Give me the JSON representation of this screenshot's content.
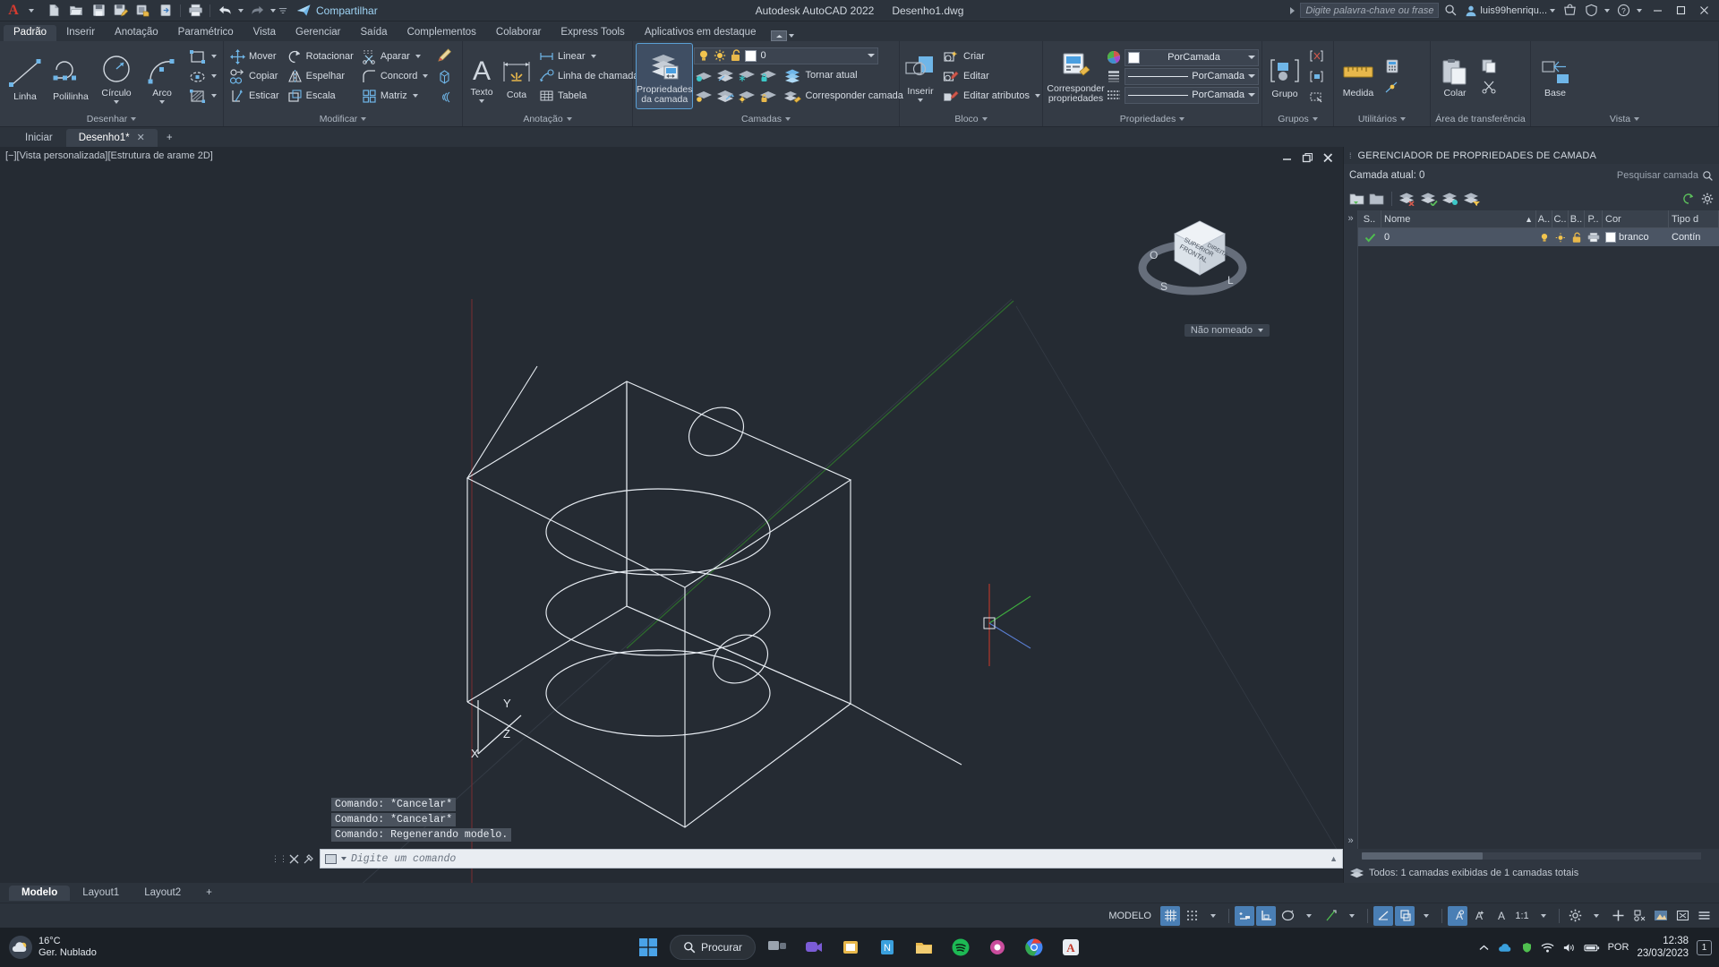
{
  "titlebar": {
    "app_title": "Autodesk AutoCAD 2022",
    "file_name": "Desenho1.dwg",
    "share_label": "Compartilhar",
    "search_placeholder": "Digite palavra-chave ou frase",
    "user_name": "luis99henriqu...",
    "qat_items": [
      "new-icon",
      "open-icon",
      "save-icon",
      "save-as-icon",
      "plot-preview-icon",
      "export-icon",
      "print-icon",
      "undo-icon",
      "redo-icon",
      "customize-icon"
    ],
    "window_controls": [
      "minimize",
      "maximize",
      "close"
    ]
  },
  "ribbon": {
    "tabs": [
      {
        "label": "Padrão",
        "active": true
      },
      {
        "label": "Inserir",
        "active": false
      },
      {
        "label": "Anotação",
        "active": false
      },
      {
        "label": "Paramétrico",
        "active": false
      },
      {
        "label": "Vista",
        "active": false
      },
      {
        "label": "Gerenciar",
        "active": false
      },
      {
        "label": "Saída",
        "active": false
      },
      {
        "label": "Complementos",
        "active": false
      },
      {
        "label": "Colaborar",
        "active": false
      },
      {
        "label": "Express Tools",
        "active": false
      },
      {
        "label": "Aplicativos em destaque",
        "active": false
      }
    ],
    "panels": {
      "desenhar": {
        "title": "Desenhar",
        "big": [
          {
            "label": "Linha",
            "icon": "line-icon"
          },
          {
            "label": "Polilinha",
            "icon": "polyline-icon"
          },
          {
            "label": "Círculo",
            "icon": "circle-icon",
            "dropdown": true
          },
          {
            "label": "Arco",
            "icon": "arc-icon",
            "dropdown": true
          }
        ],
        "small_icons": [
          "rectangle-icon",
          "ellipse-icon",
          "hatch-icon"
        ]
      },
      "modificar": {
        "title": "Modificar",
        "items": [
          {
            "label": "Mover",
            "icon": "move-icon"
          },
          {
            "label": "Rotacionar",
            "icon": "rotate-icon"
          },
          {
            "label": "Aparar",
            "icon": "trim-icon",
            "dropdown": true
          },
          {
            "label": "Copiar",
            "icon": "copy-icon"
          },
          {
            "label": "Espelhar",
            "icon": "mirror-icon"
          },
          {
            "label": "Concord",
            "icon": "fillet-icon",
            "dropdown": true
          },
          {
            "label": "Esticar",
            "icon": "stretch-icon"
          },
          {
            "label": "Escala",
            "icon": "scale-icon"
          },
          {
            "label": "Matriz",
            "icon": "array-icon",
            "dropdown": true
          }
        ],
        "extra_icons": [
          "erase-brush-icon",
          "solid-edit-icon",
          "offset-icon"
        ]
      },
      "anotacao": {
        "title": "Anotação",
        "big": [
          {
            "label": "Texto",
            "icon": "text-icon",
            "dropdown": true
          },
          {
            "label": "Cota",
            "icon": "dimension-icon"
          }
        ],
        "items": [
          {
            "label": "Linear",
            "icon": "linear-dim-icon",
            "dropdown": true
          },
          {
            "label": "Linha de chamada",
            "icon": "leader-icon",
            "dropdown": true
          },
          {
            "label": "Tabela",
            "icon": "table-icon"
          }
        ]
      },
      "camadas": {
        "title": "Camadas",
        "big": {
          "label": "Propriedades da camada",
          "icon": "layer-properties-icon",
          "selected": true
        },
        "layer_value": "0",
        "toggle_icons": [
          "lightbulb-on-icon",
          "sun-icon",
          "unlock-icon"
        ],
        "items": [
          {
            "label": "Tornar atual",
            "icon": "make-current-icon"
          },
          {
            "label": "Corresponder camada",
            "icon": "match-layer-icon"
          }
        ],
        "row1_icons": [
          "layer-isolate-icon",
          "layer-off-icon",
          "layer-freeze-icon",
          "layer-lock-icon"
        ],
        "row2_icons": [
          "layer-unisolate-icon",
          "layer-on-icon",
          "layer-thaw-icon",
          "layer-unlock-icon"
        ]
      },
      "bloco": {
        "title": "Bloco",
        "big": {
          "label": "Inserir",
          "icon": "insert-block-icon",
          "dropdown": true
        },
        "items": [
          {
            "label": "Criar",
            "icon": "create-block-icon"
          },
          {
            "label": "Editar",
            "icon": "edit-block-icon"
          },
          {
            "label": "Editar atributos",
            "icon": "edit-attributes-icon",
            "dropdown": true
          }
        ]
      },
      "propriedades": {
        "title": "Propriedades",
        "big": {
          "label": "Corresponder propriedades",
          "icon": "match-properties-icon"
        },
        "rows": [
          {
            "icon": "color-wheel-icon",
            "value": "PorCamada",
            "kind": "color"
          },
          {
            "icon": "lineweight-icon",
            "value": "PorCamada",
            "kind": "line"
          },
          {
            "icon": "linetype-icon",
            "value": "PorCamada",
            "kind": "line"
          }
        ]
      },
      "grupos": {
        "title": "Grupos",
        "big": {
          "label": "Grupo",
          "icon": "group-icon"
        },
        "side_icons": [
          "ungroup-icon",
          "group-edit-icon",
          "group-select-icon"
        ]
      },
      "utilitarios": {
        "title": "Utilitários",
        "big": {
          "label": "Medida",
          "icon": "measure-icon"
        },
        "side_icons": [
          "quick-calc-icon",
          "id-point-icon"
        ]
      },
      "area_transferencia": {
        "title": "Área de transferência",
        "big": {
          "label": "Colar",
          "icon": "paste-icon"
        },
        "side_icons": [
          "copy-clip-icon",
          "cut-clip-icon"
        ]
      },
      "vista": {
        "title": "Vista",
        "big": {
          "label": "Base",
          "icon": "base-view-icon"
        }
      }
    }
  },
  "document_tabs": [
    {
      "label": "Iniciar",
      "active": false,
      "closable": false
    },
    {
      "label": "Desenho1*",
      "active": true,
      "closable": true
    }
  ],
  "document_tab_add": "+",
  "canvas": {
    "viewport_label": "[−][Vista personalizada][Estrutura de arame 2D]",
    "viewcube_faces": {
      "front": "FRONTAL",
      "right": "DIREITA",
      "top": "SUPERIOR"
    },
    "compass": {
      "north": "O",
      "south": "S",
      "east": "L"
    },
    "viewcube_menu": "Não nomeado",
    "ucs_axes": [
      "X",
      "Y",
      "Z"
    ],
    "window_controls": [
      "minimize",
      "restore",
      "close"
    ]
  },
  "command": {
    "history": [
      "Comando: *Cancelar*",
      "Comando: *Cancelar*",
      "Comando:  Regenerando modelo."
    ],
    "placeholder": "Digite um comando"
  },
  "layer_palette": {
    "title": "GERENCIADOR DE PROPRIEDADES DE CAMADA",
    "current_layer_label": "Camada atual: 0",
    "search_placeholder": "Pesquisar camada",
    "columns": [
      "S..",
      "Nome",
      "A..",
      "C..",
      "B..",
      "P..",
      "Cor",
      "Tipo d"
    ],
    "rows": [
      {
        "status": "current",
        "nome": "0",
        "a": "on",
        "c": "on",
        "b": "unlock",
        "p": "plot",
        "cor": "branco",
        "tipo": "Contín"
      }
    ],
    "footer": "Todos: 1 camadas exibidas de 1 camadas totais",
    "toolbar_icons": [
      "new-layer-icon",
      "new-layer-vp-icon",
      "delete-layer-icon",
      "set-current-icon",
      "layer-states-icon",
      "layer-filter-icon"
    ],
    "toolbar_right_icons": [
      "refresh-icon",
      "settings-icon"
    ]
  },
  "layout_tabs": [
    {
      "label": "Modelo",
      "active": true
    },
    {
      "label": "Layout1",
      "active": false
    },
    {
      "label": "Layout2",
      "active": false
    }
  ],
  "layout_add": "+",
  "statusbar": {
    "space_label": "MODELO",
    "scale": "1:1",
    "toggles": [
      {
        "name": "grid-display-toggle",
        "on": true
      },
      {
        "name": "snap-mode-toggle",
        "on": false
      },
      {
        "name": "infer-constraints-toggle",
        "on": true
      },
      {
        "name": "ortho-mode-toggle",
        "on": true
      },
      {
        "name": "polar-tracking-toggle",
        "on": false
      },
      {
        "name": "object-snap-tracking-toggle",
        "on": false
      },
      {
        "name": "object-snap-toggle",
        "on": true
      },
      {
        "name": "lineweight-toggle",
        "on": true
      },
      {
        "name": "transparency-toggle",
        "on": false
      },
      {
        "name": "annotation-visibility-toggle",
        "on": true
      },
      {
        "name": "autoscale-toggle",
        "on": false
      },
      {
        "name": "annotation-scale-toggle",
        "on": false
      },
      {
        "name": "workspace-switching-icon",
        "on": false
      },
      {
        "name": "hardware-acceleration-icon",
        "on": false
      },
      {
        "name": "isolate-objects-icon",
        "on": false
      },
      {
        "name": "clean-screen-icon",
        "on": false
      },
      {
        "name": "customization-icon",
        "on": false
      }
    ]
  },
  "taskbar": {
    "weather_temp": "16°C",
    "weather_desc": "Ger. Nublado",
    "search_label": "Procurar",
    "apps": [
      "windows-start-icon",
      "task-view-icon",
      "teams-icon",
      "store-icon",
      "notepad-icon",
      "explorer-icon",
      "spotify-icon",
      "camera-icon",
      "chrome-icon",
      "autocad-icon"
    ],
    "tray": {
      "language": "POR",
      "time": "12:38",
      "date": "23/03/2023",
      "notification_count": "1",
      "icons": [
        "show-hidden-icon",
        "onedrive-icon",
        "shield-icon",
        "wifi-icon",
        "volume-icon",
        "battery-icon"
      ]
    }
  },
  "colors": {
    "accent": "#4a7fb5",
    "ribbon_bg": "#343b45",
    "canvas_bg": "#252b33",
    "selection": "#5a9fd4",
    "axis_x": "#c0392b",
    "axis_y": "#3fae3f",
    "axis_z": "#4a7fb5"
  }
}
